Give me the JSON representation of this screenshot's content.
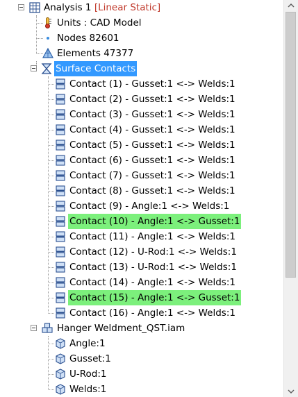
{
  "tree": {
    "analysis": {
      "name": "Analysis 1",
      "type": "[Linear Static]"
    },
    "units": "Units : CAD Model",
    "nodes": "Nodes 82601",
    "elements": "Elements 47377",
    "surface_contacts": "Surface Contacts",
    "contacts": [
      {
        "label": "Contact (1) - Gusset:1 <-> Welds:1",
        "state": "normal"
      },
      {
        "label": "Contact (2) - Gusset:1 <-> Welds:1",
        "state": "normal"
      },
      {
        "label": "Contact (3) - Gusset:1 <-> Welds:1",
        "state": "normal"
      },
      {
        "label": "Contact (4) - Gusset:1 <-> Welds:1",
        "state": "normal"
      },
      {
        "label": "Contact (5) - Gusset:1 <-> Welds:1",
        "state": "normal"
      },
      {
        "label": "Contact (6) - Gusset:1 <-> Welds:1",
        "state": "normal"
      },
      {
        "label": "Contact (7) - Gusset:1 <-> Welds:1",
        "state": "normal"
      },
      {
        "label": "Contact (8) - Gusset:1 <-> Welds:1",
        "state": "normal"
      },
      {
        "label": "Contact (9) - Angle:1 <-> Welds:1",
        "state": "normal"
      },
      {
        "label": "Contact (10) - Angle:1 <-> Gusset:1",
        "state": "highlighted"
      },
      {
        "label": "Contact (11) - Angle:1 <-> Welds:1",
        "state": "normal"
      },
      {
        "label": "Contact (12) - U-Rod:1 <-> Welds:1",
        "state": "normal"
      },
      {
        "label": "Contact (13) - U-Rod:1 <-> Welds:1",
        "state": "normal"
      },
      {
        "label": "Contact (14) - Angle:1 <-> Welds:1",
        "state": "normal"
      },
      {
        "label": "Contact (15) - Angle:1 <-> Gusset:1",
        "state": "highlighted"
      },
      {
        "label": "Contact (16) - Angle:1 <-> Welds:1",
        "state": "normal"
      }
    ],
    "assembly": "Hanger Weldment_QST.iam",
    "parts": [
      "Angle:1",
      "Gusset:1",
      "U-Rod:1",
      "Welds:1"
    ]
  },
  "colors": {
    "selection": "#3399ff",
    "highlight": "#7cf07c",
    "analysis_type": "#c0392b"
  },
  "icons": {
    "analysis": "analysis-grid-icon",
    "units": "thermometer-icon",
    "nodes": "node-dot-icon",
    "elements": "mesh-element-icon",
    "surface_contacts": "contact-hourglass-icon",
    "contact": "contact-pair-icon",
    "assembly": "assembly-icon",
    "part": "part-cube-icon"
  }
}
